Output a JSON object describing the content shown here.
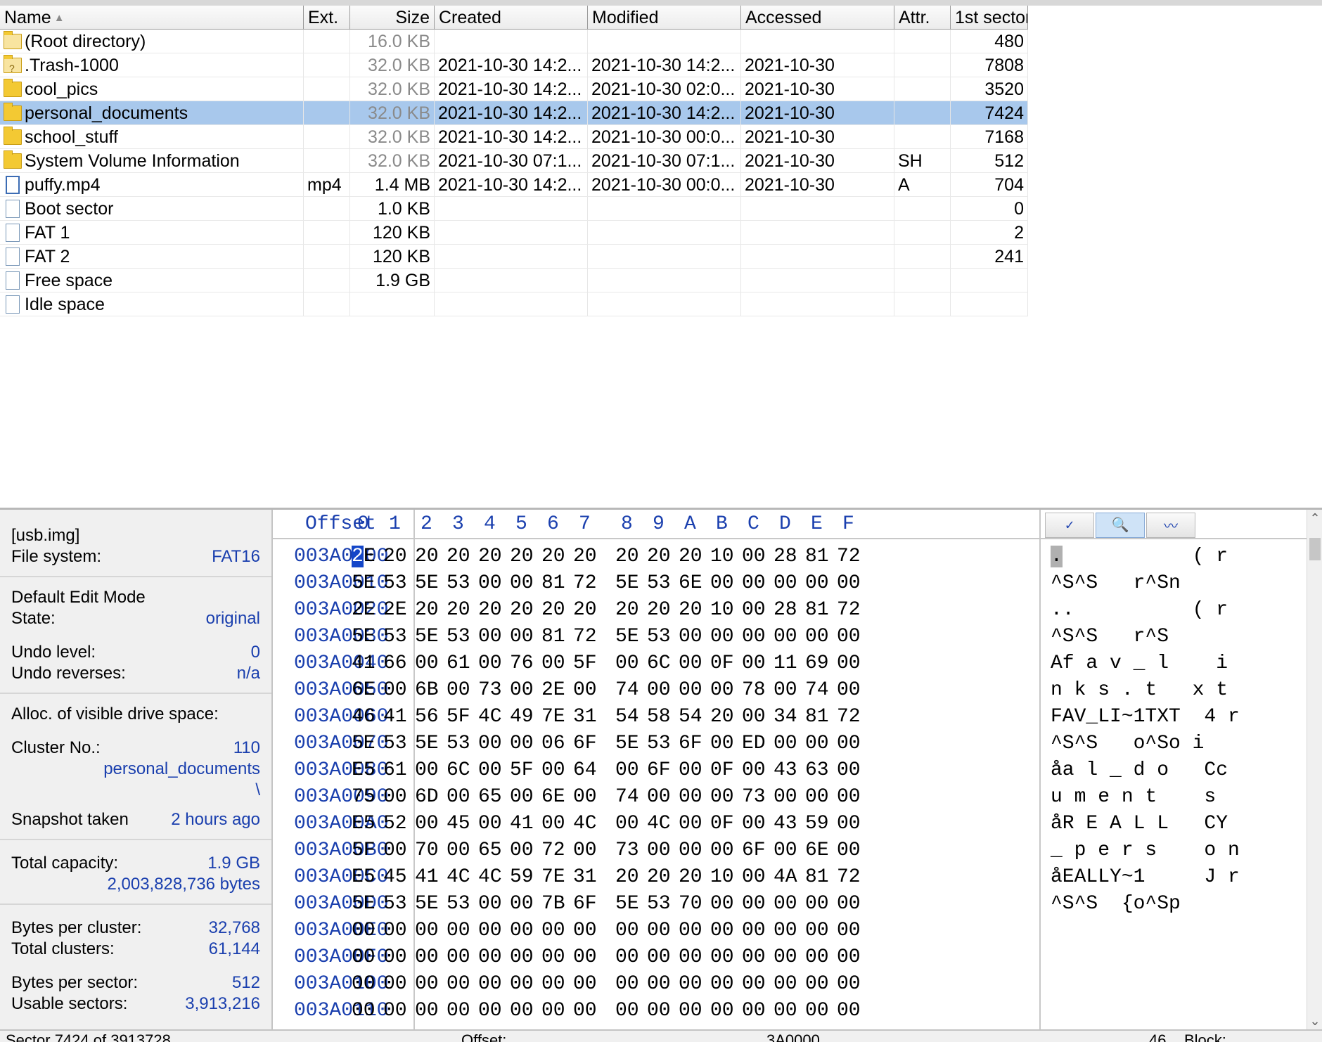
{
  "file_list": {
    "columns": {
      "name": "Name",
      "ext": "Ext.",
      "size": "Size",
      "created": "Created",
      "modified": "Modified",
      "accessed": "Accessed",
      "attr": "Attr.",
      "first_sector": "1st sector"
    },
    "sort_icon": "sort-ascending-icon",
    "rows": [
      {
        "icon": "folder-up-icon",
        "name": "(Root directory)",
        "ext": "",
        "size": "16.0 KB",
        "created": "",
        "modified": "",
        "accessed": "",
        "attr": "",
        "first_sector": "480"
      },
      {
        "icon": "folder-unknown-icon",
        "name": ".Trash-1000",
        "ext": "",
        "size": "32.0 KB",
        "created": "2021-10-30  14:2...",
        "modified": "2021-10-30  14:2...",
        "accessed": "2021-10-30",
        "attr": "",
        "first_sector": "7808"
      },
      {
        "icon": "folder-icon",
        "name": "cool_pics",
        "ext": "",
        "size": "32.0 KB",
        "created": "2021-10-30  14:2...",
        "modified": "2021-10-30  02:0...",
        "accessed": "2021-10-30",
        "attr": "",
        "first_sector": "3520"
      },
      {
        "icon": "folder-icon",
        "name": "personal_documents",
        "ext": "",
        "size": "32.0 KB",
        "created": "2021-10-30  14:2...",
        "modified": "2021-10-30  14:2...",
        "accessed": "2021-10-30",
        "attr": "",
        "first_sector": "7424",
        "selected": true
      },
      {
        "icon": "folder-icon",
        "name": "school_stuff",
        "ext": "",
        "size": "32.0 KB",
        "created": "2021-10-30  14:2...",
        "modified": "2021-10-30  00:0...",
        "accessed": "2021-10-30",
        "attr": "",
        "first_sector": "7168"
      },
      {
        "icon": "folder-icon",
        "name": "System Volume Information",
        "ext": "",
        "size": "32.0 KB",
        "created": "2021-10-30  07:1...",
        "modified": "2021-10-30  07:1...",
        "accessed": "2021-10-30",
        "attr": "SH",
        "first_sector": "512"
      },
      {
        "icon": "file-icon",
        "name": "puffy.mp4",
        "ext": "mp4",
        "size": "1.4 MB",
        "created": "2021-10-30  14:2...",
        "modified": "2021-10-30  00:0...",
        "accessed": "2021-10-30",
        "attr": "A",
        "first_sector": "704"
      },
      {
        "icon": "virtual-file-icon",
        "name": "Boot sector",
        "ext": "",
        "size": "1.0 KB",
        "created": "",
        "modified": "",
        "accessed": "",
        "attr": "",
        "first_sector": "0"
      },
      {
        "icon": "virtual-file-icon",
        "name": "FAT 1",
        "ext": "",
        "size": "120 KB",
        "created": "",
        "modified": "",
        "accessed": "",
        "attr": "",
        "first_sector": "2"
      },
      {
        "icon": "virtual-file-icon",
        "name": "FAT 2",
        "ext": "",
        "size": "120 KB",
        "created": "",
        "modified": "",
        "accessed": "",
        "attr": "",
        "first_sector": "241"
      },
      {
        "icon": "virtual-file-icon",
        "name": "Free space",
        "ext": "",
        "size": "1.9 GB",
        "created": "",
        "modified": "",
        "accessed": "",
        "attr": "",
        "first_sector": ""
      },
      {
        "icon": "virtual-file-icon",
        "name": "Idle space",
        "ext": "",
        "size": "",
        "created": "",
        "modified": "",
        "accessed": "",
        "attr": "",
        "first_sector": ""
      }
    ]
  },
  "info_panel": {
    "volume": "[usb.img]",
    "file_system_label": "File system:",
    "file_system_value": "FAT16",
    "edit_mode_label": "Default Edit Mode",
    "state_label": "State:",
    "state_value": "original",
    "undo_level_label": "Undo level:",
    "undo_level_value": "0",
    "undo_reverses_label": "Undo reverses:",
    "undo_reverses_value": "n/a",
    "alloc_label": "Alloc. of visible drive space:",
    "cluster_label": "Cluster No.:",
    "cluster_value": "110",
    "cluster_name": "personal_documents",
    "cluster_path": "\\",
    "snapshot_label": "Snapshot taken",
    "snapshot_value": "2 hours ago",
    "capacity_label": "Total capacity:",
    "capacity_value": "1.9 GB",
    "capacity_bytes": "2,003,828,736 bytes",
    "bytes_per_cluster_label": "Bytes per cluster:",
    "bytes_per_cluster_value": "32,768",
    "total_clusters_label": "Total clusters:",
    "total_clusters_value": "61,144",
    "bytes_per_sector_label": "Bytes per sector:",
    "bytes_per_sector_value": "512",
    "usable_sectors_label": "Usable sectors:",
    "usable_sectors_value": "3,913,216"
  },
  "hex_view": {
    "offset_header": "Offset",
    "column_headers": [
      "0",
      "1",
      "2",
      "3",
      "4",
      "5",
      "6",
      "7",
      "8",
      "9",
      "A",
      "B",
      "C",
      "D",
      "E",
      "F"
    ],
    "toolbar_icons": [
      "checkmark-icon",
      "search-folder-icon",
      "wave-icon"
    ],
    "rows": [
      {
        "offset": "003A0000",
        "bytes": [
          "2E",
          "20",
          "20",
          "20",
          "20",
          "20",
          "20",
          "20",
          "20",
          "20",
          "20",
          "10",
          "00",
          "28",
          "81",
          "72"
        ],
        "text": ".           ( r"
      },
      {
        "offset": "003A0010",
        "bytes": [
          "5E",
          "53",
          "5E",
          "53",
          "00",
          "00",
          "81",
          "72",
          "5E",
          "53",
          "6E",
          "00",
          "00",
          "00",
          "00",
          "00"
        ],
        "text": "^S^S   r^Sn"
      },
      {
        "offset": "003A0020",
        "bytes": [
          "2E",
          "2E",
          "20",
          "20",
          "20",
          "20",
          "20",
          "20",
          "20",
          "20",
          "20",
          "10",
          "00",
          "28",
          "81",
          "72"
        ],
        "text": "..          ( r"
      },
      {
        "offset": "003A0030",
        "bytes": [
          "5E",
          "53",
          "5E",
          "53",
          "00",
          "00",
          "81",
          "72",
          "5E",
          "53",
          "00",
          "00",
          "00",
          "00",
          "00",
          "00"
        ],
        "text": "^S^S   r^S"
      },
      {
        "offset": "003A0040",
        "bytes": [
          "41",
          "66",
          "00",
          "61",
          "00",
          "76",
          "00",
          "5F",
          "00",
          "6C",
          "00",
          "0F",
          "00",
          "11",
          "69",
          "00"
        ],
        "text": "Af a v _ l    i"
      },
      {
        "offset": "003A0050",
        "bytes": [
          "6E",
          "00",
          "6B",
          "00",
          "73",
          "00",
          "2E",
          "00",
          "74",
          "00",
          "00",
          "00",
          "78",
          "00",
          "74",
          "00"
        ],
        "text": "n k s . t   x t"
      },
      {
        "offset": "003A0060",
        "bytes": [
          "46",
          "41",
          "56",
          "5F",
          "4C",
          "49",
          "7E",
          "31",
          "54",
          "58",
          "54",
          "20",
          "00",
          "34",
          "81",
          "72"
        ],
        "text": "FAV_LI~1TXT  4 r"
      },
      {
        "offset": "003A0070",
        "bytes": [
          "5E",
          "53",
          "5E",
          "53",
          "00",
          "00",
          "06",
          "6F",
          "5E",
          "53",
          "6F",
          "00",
          "ED",
          "00",
          "00",
          "00"
        ],
        "text": "^S^S   o^So i"
      },
      {
        "offset": "003A0080",
        "bytes": [
          "E5",
          "61",
          "00",
          "6C",
          "00",
          "5F",
          "00",
          "64",
          "00",
          "6F",
          "00",
          "0F",
          "00",
          "43",
          "63",
          "00"
        ],
        "text": "åa l _ d o   Cc"
      },
      {
        "offset": "003A0090",
        "bytes": [
          "75",
          "00",
          "6D",
          "00",
          "65",
          "00",
          "6E",
          "00",
          "74",
          "00",
          "00",
          "00",
          "73",
          "00",
          "00",
          "00"
        ],
        "text": "u m e n t    s"
      },
      {
        "offset": "003A00A0",
        "bytes": [
          "E5",
          "52",
          "00",
          "45",
          "00",
          "41",
          "00",
          "4C",
          "00",
          "4C",
          "00",
          "0F",
          "00",
          "43",
          "59",
          "00"
        ],
        "text": "åR E A L L   CY"
      },
      {
        "offset": "003A00B0",
        "bytes": [
          "5F",
          "00",
          "70",
          "00",
          "65",
          "00",
          "72",
          "00",
          "73",
          "00",
          "00",
          "00",
          "6F",
          "00",
          "6E",
          "00"
        ],
        "text": "_ p e r s    o n"
      },
      {
        "offset": "003A00C0",
        "bytes": [
          "E5",
          "45",
          "41",
          "4C",
          "4C",
          "59",
          "7E",
          "31",
          "20",
          "20",
          "20",
          "10",
          "00",
          "4A",
          "81",
          "72"
        ],
        "text": "åEALLY~1     J r"
      },
      {
        "offset": "003A00D0",
        "bytes": [
          "5E",
          "53",
          "5E",
          "53",
          "00",
          "00",
          "7B",
          "6F",
          "5E",
          "53",
          "70",
          "00",
          "00",
          "00",
          "00",
          "00"
        ],
        "text": "^S^S  {o^Sp"
      },
      {
        "offset": "003A00E0",
        "bytes": [
          "00",
          "00",
          "00",
          "00",
          "00",
          "00",
          "00",
          "00",
          "00",
          "00",
          "00",
          "00",
          "00",
          "00",
          "00",
          "00"
        ],
        "text": ""
      },
      {
        "offset": "003A00F0",
        "bytes": [
          "00",
          "00",
          "00",
          "00",
          "00",
          "00",
          "00",
          "00",
          "00",
          "00",
          "00",
          "00",
          "00",
          "00",
          "00",
          "00"
        ],
        "text": ""
      },
      {
        "offset": "003A0100",
        "bytes": [
          "00",
          "00",
          "00",
          "00",
          "00",
          "00",
          "00",
          "00",
          "00",
          "00",
          "00",
          "00",
          "00",
          "00",
          "00",
          "00"
        ],
        "text": ""
      },
      {
        "offset": "003A0110",
        "bytes": [
          "00",
          "00",
          "00",
          "00",
          "00",
          "00",
          "00",
          "00",
          "00",
          "00",
          "00",
          "00",
          "00",
          "00",
          "00",
          "00"
        ],
        "text": ""
      }
    ]
  },
  "status_bar": {
    "sector": "Sector 7424 of 3913728",
    "offset_label": "Offset:",
    "offset_value": "3A0000",
    "value": "46",
    "block_label": "Block:"
  }
}
